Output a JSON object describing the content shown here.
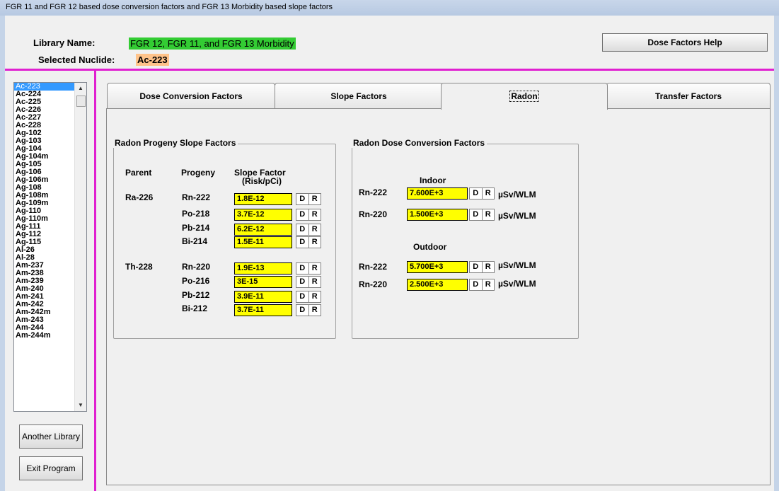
{
  "window": {
    "title": "FGR 11 and FGR 12 based dose conversion factors and FGR 13 Morbidity based slope factors"
  },
  "header": {
    "library_label": "Library Name:",
    "library_value": "FGR 12, FGR 11, and FGR 13 Morbidity",
    "nuclide_label": "Selected Nuclide:",
    "nuclide_value": "Ac-223",
    "help_button": "Dose Factors Help"
  },
  "nuclide_list": {
    "selected": "Ac-223",
    "items": [
      "Ac-223",
      "Ac-224",
      "Ac-225",
      "Ac-226",
      "Ac-227",
      "Ac-228",
      "Ag-102",
      "Ag-103",
      "Ag-104",
      "Ag-104m",
      "Ag-105",
      "Ag-106",
      "Ag-106m",
      "Ag-108",
      "Ag-108m",
      "Ag-109m",
      "Ag-110",
      "Ag-110m",
      "Ag-111",
      "Ag-112",
      "Ag-115",
      "Al-26",
      "Al-28",
      "Am-237",
      "Am-238",
      "Am-239",
      "Am-240",
      "Am-241",
      "Am-242",
      "Am-242m",
      "Am-243",
      "Am-244",
      "Am-244m"
    ]
  },
  "buttons": {
    "another_library": "Another Library",
    "exit_program": "Exit Program"
  },
  "tabs": [
    "Dose Conversion Factors",
    "Slope Factors",
    "Radon",
    "Transfer Factors"
  ],
  "active_tab": "Radon",
  "progeny_group": {
    "title": "Radon Progeny Slope Factors",
    "col_parent": "Parent",
    "col_progeny": "Progeny",
    "col_slope_line1": "Slope Factor",
    "col_slope_line2": "(Risk/pCi)",
    "parents": [
      {
        "parent": "Ra-226",
        "rows": [
          {
            "progeny": "Rn-222",
            "value": "1.8E-12"
          },
          {
            "progeny": "Po-218",
            "value": "3.7E-12"
          },
          {
            "progeny": "Pb-214",
            "value": "6.2E-12"
          },
          {
            "progeny": "Bi-214",
            "value": "1.5E-11"
          }
        ]
      },
      {
        "parent": "Th-228",
        "rows": [
          {
            "progeny": "Rn-220",
            "value": "1.9E-13"
          },
          {
            "progeny": "Po-216",
            "value": "3E-15"
          },
          {
            "progeny": "Pb-212",
            "value": "3.9E-11"
          },
          {
            "progeny": "Bi-212",
            "value": "3.7E-11"
          }
        ]
      }
    ]
  },
  "dcf_group": {
    "title": "Radon Dose Conversion Factors",
    "indoor_label": "Indoor",
    "outdoor_label": "Outdoor",
    "unit": "µSv/WLM",
    "indoor": [
      {
        "nuclide": "Rn-222",
        "value": "7.600E+3"
      },
      {
        "nuclide": "Rn-220",
        "value": "1.500E+3"
      }
    ],
    "outdoor": [
      {
        "nuclide": "Rn-222",
        "value": "5.700E+3"
      },
      {
        "nuclide": "Rn-220",
        "value": "2.500E+3"
      }
    ]
  },
  "dr_buttons": {
    "d": "D",
    "r": "R"
  }
}
